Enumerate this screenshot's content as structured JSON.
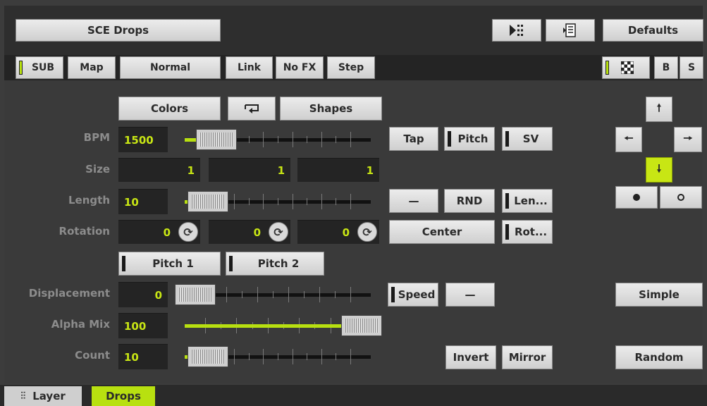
{
  "header": {
    "title": "SCE Drops",
    "defaults_label": "Defaults"
  },
  "toolbar": {
    "sub": "SUB",
    "map": "Map",
    "mode": "Normal",
    "link": "Link",
    "nofx": "No FX",
    "step": "Step",
    "b": "B",
    "s": "S"
  },
  "top_buttons": {
    "colors": "Colors",
    "shapes": "Shapes"
  },
  "params": {
    "bpm": {
      "label": "BPM",
      "value": "1500",
      "slider": 0.08
    },
    "size": {
      "label": "Size",
      "x": "1",
      "y": "1",
      "z": "1"
    },
    "length": {
      "label": "Length",
      "value": "10",
      "slider": 0.02
    },
    "rotation": {
      "label": "Rotation",
      "x": "0",
      "y": "0",
      "z": "0"
    },
    "displacement": {
      "label": "Displacement",
      "value": "0",
      "slider": 0.0
    },
    "alpha_mix": {
      "label": "Alpha Mix",
      "value": "100",
      "slider": 1.0
    },
    "count": {
      "label": "Count",
      "value": "10",
      "slider": 0.02
    }
  },
  "pitch_buttons": {
    "pitch1": "Pitch 1",
    "pitch2": "Pitch 2"
  },
  "side_buttons": {
    "tap": "Tap",
    "pitch": "Pitch",
    "sv": "SV",
    "dash1": "—",
    "rnd": "RND",
    "len": "Len...",
    "center": "Center",
    "rot": "Rot...",
    "speed": "Speed",
    "dash2": "—",
    "invert": "Invert",
    "mirror": "Mirror"
  },
  "right_buttons": {
    "simple": "Simple",
    "random": "Random"
  },
  "tabs": {
    "layer": "Layer",
    "drops": "Drops"
  },
  "colors": {
    "accent": "#b8e010",
    "value": "#c8e614"
  }
}
